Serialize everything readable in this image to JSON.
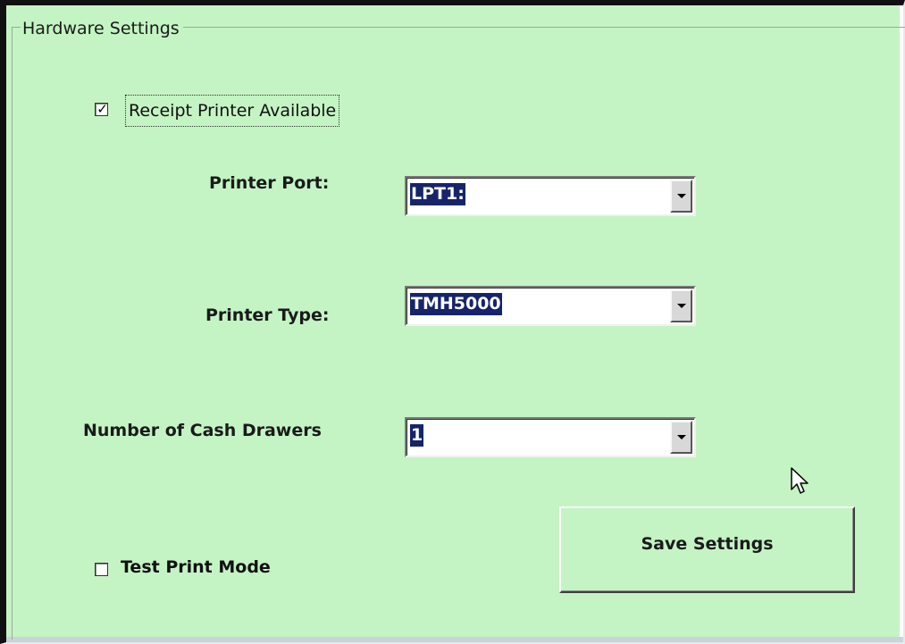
{
  "group": {
    "title": "Hardware Settings"
  },
  "receipt_printer": {
    "label": "Receipt Printer Available",
    "checked": true
  },
  "printer_port": {
    "label": "Printer Port:",
    "value": "LPT1:"
  },
  "printer_type": {
    "label": "Printer Type:",
    "value": "TMH5000"
  },
  "cash_drawers": {
    "label": "Number of Cash Drawers",
    "value": "1"
  },
  "test_print": {
    "label": "Test Print Mode",
    "checked": false
  },
  "save_button": {
    "label": "Save Settings"
  },
  "colors": {
    "background": "#c4f4c4",
    "selection": "#16246a"
  },
  "icons": {
    "checkmark": "checkmark-icon",
    "dropdown": "chevron-down-icon",
    "cursor": "mouse-pointer-icon"
  }
}
